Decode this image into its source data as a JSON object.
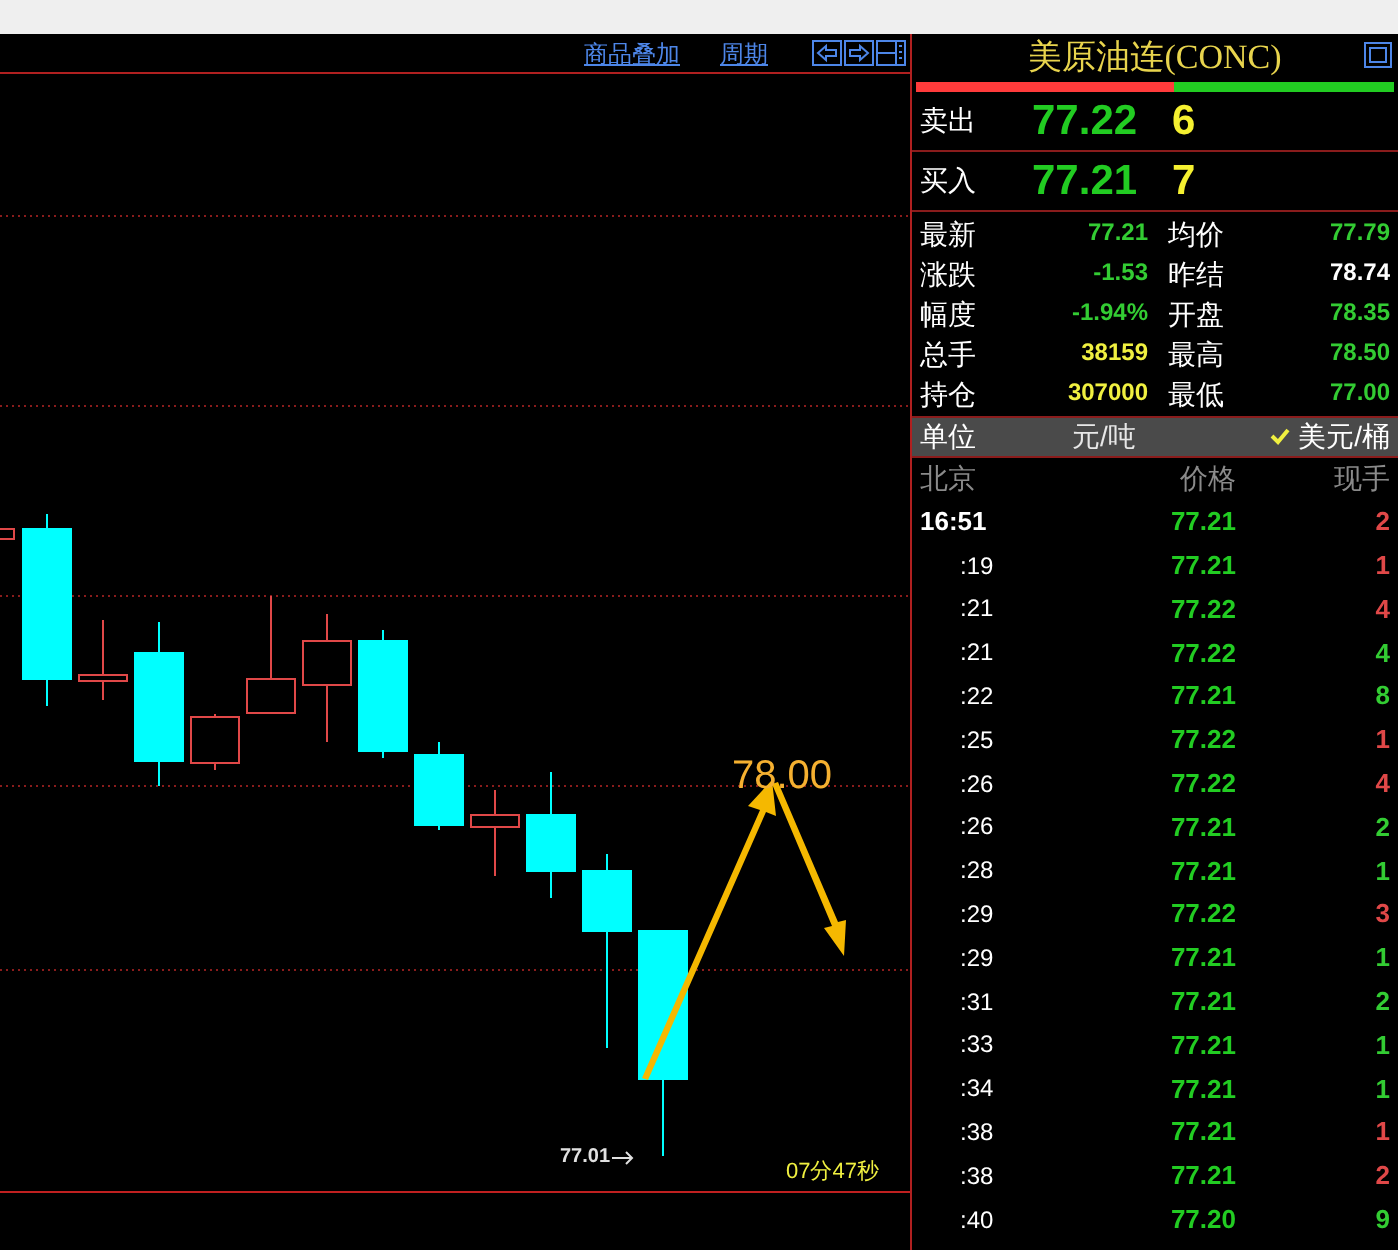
{
  "chart_panel": {
    "links": [
      {
        "label": "商品叠加"
      },
      {
        "label": "周期"
      }
    ],
    "target_label": "78.00",
    "low_label": "77.01",
    "timer": "07分47秒"
  },
  "quote_panel": {
    "title": "美原油连(CONC)",
    "ratio_bar": {
      "level": 0.54
    },
    "ask": {
      "label": "卖出",
      "price": "77.22",
      "volume": "6"
    },
    "bid": {
      "label": "买入",
      "price": "77.21",
      "volume": "7"
    },
    "stats": [
      {
        "cells": [
          {
            "label": "最新",
            "value": "77.21",
            "color": "#33cc33"
          },
          {
            "label": "均价",
            "value": "77.79",
            "color": "#33cc33"
          }
        ]
      },
      {
        "cells": [
          {
            "label": "涨跌",
            "value": "-1.53",
            "color": "#33cc33"
          },
          {
            "label": "昨结",
            "value": "78.74",
            "color": "#ffffff"
          }
        ]
      },
      {
        "cells": [
          {
            "label": "幅度",
            "value": "-1.94%",
            "color": "#33cc33"
          },
          {
            "label": "开盘",
            "value": "78.35",
            "color": "#33cc33"
          }
        ]
      },
      {
        "cells": [
          {
            "label": "总手",
            "value": "38159",
            "color": "#f0f040"
          },
          {
            "label": "最高",
            "value": "78.50",
            "color": "#33cc33"
          }
        ]
      },
      {
        "cells": [
          {
            "label": "持仓",
            "value": "307000",
            "color": "#f0f040"
          },
          {
            "label": "最低",
            "value": "77.00",
            "color": "#33cc33"
          }
        ]
      }
    ],
    "unit": {
      "label": "单位",
      "options": [
        {
          "label": "元/吨",
          "selected": false
        },
        {
          "label": "美元/桶",
          "selected": true
        }
      ]
    },
    "trades": {
      "columns": [
        "北京",
        "价格",
        "现手"
      ],
      "rows": [
        {
          "time": "16:51",
          "price": "77.21",
          "volume": "2",
          "color": "#e04848"
        },
        {
          "time": ":19",
          "price": "77.21",
          "volume": "1",
          "color": "#e04848"
        },
        {
          "time": ":21",
          "price": "77.22",
          "volume": "4",
          "color": "#e04848"
        },
        {
          "time": ":21",
          "price": "77.22",
          "volume": "4",
          "color": "#33cc33"
        },
        {
          "time": ":22",
          "price": "77.21",
          "volume": "8",
          "color": "#33cc33"
        },
        {
          "time": ":25",
          "price": "77.22",
          "volume": "1",
          "color": "#e04848"
        },
        {
          "time": ":26",
          "price": "77.22",
          "volume": "4",
          "color": "#e04848"
        },
        {
          "time": ":26",
          "price": "77.21",
          "volume": "2",
          "color": "#33cc33"
        },
        {
          "time": ":28",
          "price": "77.21",
          "volume": "1",
          "color": "#33cc33"
        },
        {
          "time": ":29",
          "price": "77.22",
          "volume": "3",
          "color": "#e04848"
        },
        {
          "time": ":29",
          "price": "77.21",
          "volume": "1",
          "color": "#33cc33"
        },
        {
          "time": ":31",
          "price": "77.21",
          "volume": "2",
          "color": "#33cc33"
        },
        {
          "time": ":33",
          "price": "77.21",
          "volume": "1",
          "color": "#33cc33"
        },
        {
          "time": ":34",
          "price": "77.21",
          "volume": "1",
          "color": "#33cc33"
        },
        {
          "time": ":38",
          "price": "77.21",
          "volume": "1",
          "color": "#e04848"
        },
        {
          "time": ":38",
          "price": "77.21",
          "volume": "2",
          "color": "#e04848"
        },
        {
          "time": ":40",
          "price": "77.20",
          "volume": "9",
          "color": "#33cc33"
        }
      ]
    }
  }
}
